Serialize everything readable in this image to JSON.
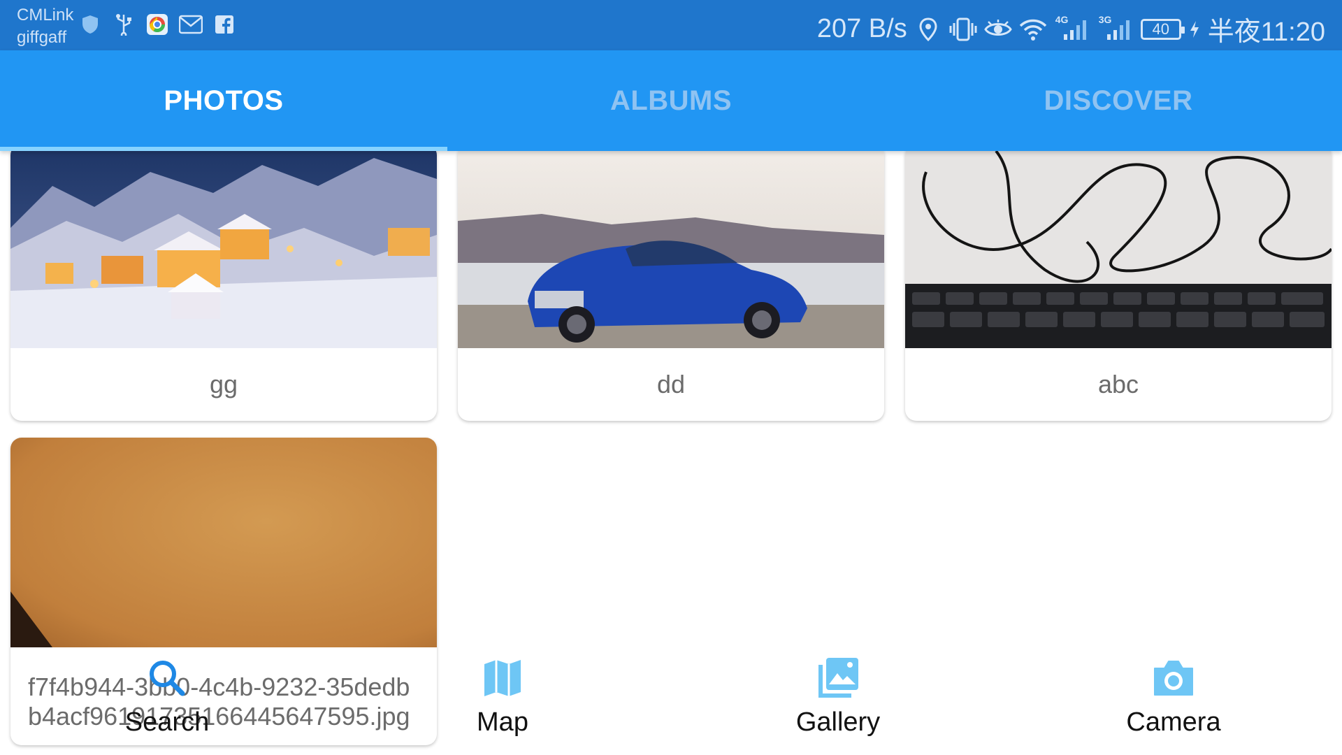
{
  "status_bar": {
    "carrier_1": "CMLink",
    "carrier_2": "giffgaff",
    "left_icons": [
      "shield-icon",
      "usb-icon",
      "chrome-icon",
      "gmail-icon",
      "facebook-icon"
    ],
    "net_speed": "207 B/s",
    "right_icons": [
      "location-icon",
      "vibrate-icon",
      "eye-icon",
      "wifi-icon",
      "signal-4g-icon",
      "signal-3g-icon"
    ],
    "signal_1_label": "4G",
    "signal_2_label": "3G",
    "battery_level": "40",
    "time": "半夜11:20",
    "bar_color": "#1f76cc"
  },
  "tabs": [
    {
      "label": "PHOTOS",
      "active": true
    },
    {
      "label": "ALBUMS",
      "active": false
    },
    {
      "label": "DISCOVER",
      "active": false
    }
  ],
  "tab_colors": {
    "background": "#2196f3",
    "active_text": "#ffffff",
    "inactive_text": "#8fc3f2",
    "indicator": "#87d3ff"
  },
  "photos": [
    {
      "caption": "gg",
      "image": "snowy-village-photo"
    },
    {
      "caption": "dd",
      "image": "blue-car-photo"
    },
    {
      "caption": "abc",
      "image": "keyboard-cable-photo"
    },
    {
      "caption": "f7f4b944-3bb0-4c4b-9232-35dedbb4acf96191735166445647595.jpg",
      "image": "orange-surface-photo"
    }
  ],
  "bottom_nav": [
    {
      "label": "Search",
      "icon": "search-icon"
    },
    {
      "label": "Map",
      "icon": "map-icon"
    },
    {
      "label": "Gallery",
      "icon": "gallery-icon"
    },
    {
      "label": "Camera",
      "icon": "camera-icon"
    }
  ],
  "accent_color": "#2196f3",
  "nav_icon_color": "#6ec6f5"
}
